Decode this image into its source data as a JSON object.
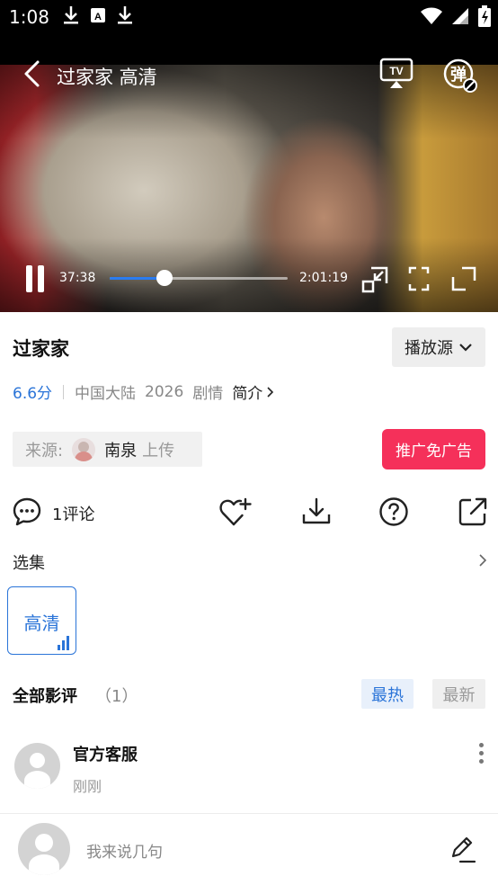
{
  "status_bar": {
    "time": "1:08"
  },
  "player": {
    "title": "过家家 高清",
    "current_time": "37:38",
    "duration": "2:01:19",
    "progress_fraction": 0.31,
    "tv_label": "TV",
    "danmaku_label": "弹"
  },
  "info": {
    "title": "过家家",
    "source_button": "播放源",
    "score": "6.6分",
    "region": "中国大陆",
    "year": "2026",
    "genre": "剧情",
    "intro_link": "简介"
  },
  "source": {
    "label": "来源:",
    "user": "南泉",
    "suffix": "上传"
  },
  "promo_button": "推广免广告",
  "actions": {
    "comments": "1评论"
  },
  "episodes": {
    "label": "选集",
    "items": [
      "高清"
    ]
  },
  "reviews": {
    "title": "全部影评",
    "count": "（1）",
    "tab_hot": "最热",
    "tab_new": "最新",
    "items": [
      {
        "name": "官方客服",
        "time": "刚刚"
      }
    ]
  },
  "comment_input": {
    "placeholder": "我来说几句"
  },
  "colors": {
    "accent": "#2a74d8",
    "promo": "#f5305a"
  }
}
